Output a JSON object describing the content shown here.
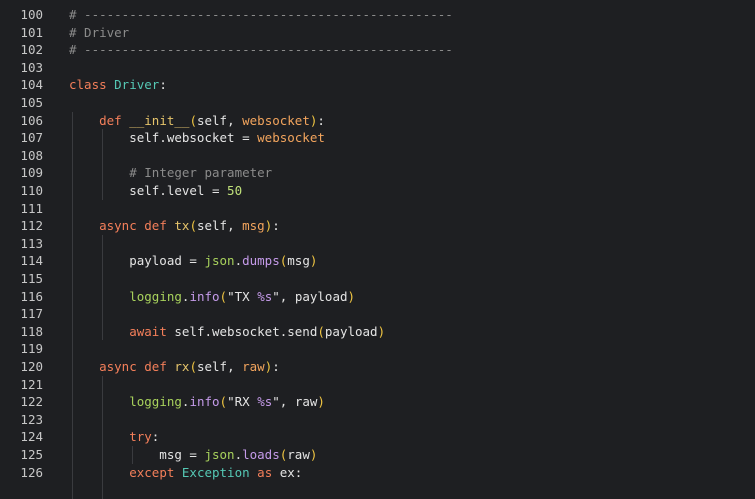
{
  "editor": {
    "lines": [
      {
        "n": "100",
        "tokens": [
          {
            "c": "comment",
            "t": "# -------------------------------------------------"
          }
        ]
      },
      {
        "n": "101",
        "tokens": [
          {
            "c": "comment",
            "t": "# Driver"
          }
        ]
      },
      {
        "n": "102",
        "tokens": [
          {
            "c": "comment",
            "t": "# -------------------------------------------------"
          }
        ]
      },
      {
        "n": "103",
        "tokens": []
      },
      {
        "n": "104",
        "tokens": [
          {
            "c": "keyword",
            "t": "class "
          },
          {
            "c": "class",
            "t": "Driver"
          },
          {
            "c": "plain",
            "t": ":"
          }
        ]
      },
      {
        "n": "105",
        "tokens": []
      },
      {
        "n": "106",
        "tokens": [
          {
            "c": "plain",
            "t": "    "
          },
          {
            "c": "keyword",
            "t": "def "
          },
          {
            "c": "func",
            "t": "__init__"
          },
          {
            "c": "paren",
            "t": "("
          },
          {
            "c": "plain",
            "t": "self, "
          },
          {
            "c": "param",
            "t": "websocket"
          },
          {
            "c": "paren",
            "t": ")"
          },
          {
            "c": "plain",
            "t": ":"
          }
        ]
      },
      {
        "n": "107",
        "tokens": [
          {
            "c": "plain",
            "t": "        self.websocket = "
          },
          {
            "c": "param",
            "t": "websocket"
          }
        ]
      },
      {
        "n": "108",
        "tokens": []
      },
      {
        "n": "109",
        "tokens": [
          {
            "c": "plain",
            "t": "        "
          },
          {
            "c": "comment",
            "t": "# Integer parameter"
          }
        ]
      },
      {
        "n": "110",
        "tokens": [
          {
            "c": "plain",
            "t": "        self.level = "
          },
          {
            "c": "number",
            "t": "50"
          }
        ]
      },
      {
        "n": "111",
        "tokens": []
      },
      {
        "n": "112",
        "tokens": [
          {
            "c": "plain",
            "t": "    "
          },
          {
            "c": "keyword",
            "t": "async def "
          },
          {
            "c": "func",
            "t": "tx"
          },
          {
            "c": "paren",
            "t": "("
          },
          {
            "c": "plain",
            "t": "self, "
          },
          {
            "c": "param",
            "t": "msg"
          },
          {
            "c": "paren",
            "t": ")"
          },
          {
            "c": "plain",
            "t": ":"
          }
        ]
      },
      {
        "n": "113",
        "tokens": []
      },
      {
        "n": "114",
        "tokens": [
          {
            "c": "plain",
            "t": "        payload = "
          },
          {
            "c": "module",
            "t": "json"
          },
          {
            "c": "plain",
            "t": "."
          },
          {
            "c": "method",
            "t": "dumps"
          },
          {
            "c": "paren",
            "t": "("
          },
          {
            "c": "plain",
            "t": "msg"
          },
          {
            "c": "paren",
            "t": ")"
          }
        ]
      },
      {
        "n": "115",
        "tokens": []
      },
      {
        "n": "116",
        "tokens": [
          {
            "c": "plain",
            "t": "        "
          },
          {
            "c": "module",
            "t": "logging"
          },
          {
            "c": "plain",
            "t": "."
          },
          {
            "c": "method",
            "t": "info"
          },
          {
            "c": "paren",
            "t": "("
          },
          {
            "c": "string",
            "t": "\"TX "
          },
          {
            "c": "fmt",
            "t": "%s"
          },
          {
            "c": "string",
            "t": "\""
          },
          {
            "c": "plain",
            "t": ", payload"
          },
          {
            "c": "paren",
            "t": ")"
          }
        ]
      },
      {
        "n": "117",
        "tokens": []
      },
      {
        "n": "118",
        "tokens": [
          {
            "c": "plain",
            "t": "        "
          },
          {
            "c": "keyword",
            "t": "await "
          },
          {
            "c": "plain",
            "t": "self.websocket.send"
          },
          {
            "c": "paren",
            "t": "("
          },
          {
            "c": "plain",
            "t": "payload"
          },
          {
            "c": "paren",
            "t": ")"
          }
        ]
      },
      {
        "n": "119",
        "tokens": []
      },
      {
        "n": "120",
        "tokens": [
          {
            "c": "plain",
            "t": "    "
          },
          {
            "c": "keyword",
            "t": "async def "
          },
          {
            "c": "func",
            "t": "rx"
          },
          {
            "c": "paren",
            "t": "("
          },
          {
            "c": "plain",
            "t": "self, "
          },
          {
            "c": "param",
            "t": "raw"
          },
          {
            "c": "paren",
            "t": ")"
          },
          {
            "c": "plain",
            "t": ":"
          }
        ]
      },
      {
        "n": "121",
        "tokens": []
      },
      {
        "n": "122",
        "tokens": [
          {
            "c": "plain",
            "t": "        "
          },
          {
            "c": "module",
            "t": "logging"
          },
          {
            "c": "plain",
            "t": "."
          },
          {
            "c": "method",
            "t": "info"
          },
          {
            "c": "paren",
            "t": "("
          },
          {
            "c": "string",
            "t": "\"RX "
          },
          {
            "c": "fmt",
            "t": "%s"
          },
          {
            "c": "string",
            "t": "\""
          },
          {
            "c": "plain",
            "t": ", raw"
          },
          {
            "c": "paren",
            "t": ")"
          }
        ]
      },
      {
        "n": "123",
        "tokens": []
      },
      {
        "n": "124",
        "tokens": [
          {
            "c": "plain",
            "t": "        "
          },
          {
            "c": "keyword",
            "t": "try"
          },
          {
            "c": "plain",
            "t": ":"
          }
        ]
      },
      {
        "n": "125",
        "tokens": [
          {
            "c": "plain",
            "t": "            msg = "
          },
          {
            "c": "module",
            "t": "json"
          },
          {
            "c": "plain",
            "t": "."
          },
          {
            "c": "method",
            "t": "loads"
          },
          {
            "c": "paren",
            "t": "("
          },
          {
            "c": "plain",
            "t": "raw"
          },
          {
            "c": "paren",
            "t": ")"
          }
        ]
      },
      {
        "n": "126",
        "tokens": [
          {
            "c": "plain",
            "t": "        "
          },
          {
            "c": "keyword",
            "t": "except "
          },
          {
            "c": "class",
            "t": "Exception"
          },
          {
            "c": "keyword",
            "t": " as "
          },
          {
            "c": "plain",
            "t": "ex:"
          }
        ]
      }
    ]
  }
}
